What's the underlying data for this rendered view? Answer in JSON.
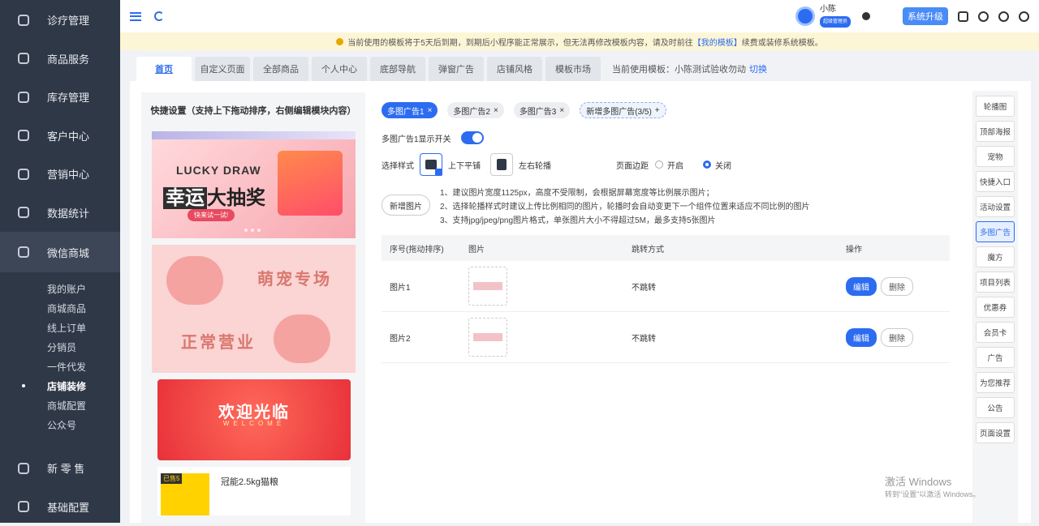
{
  "sidebar": {
    "nav": [
      {
        "label": "诊疗管理",
        "icon": "clinic-icon"
      },
      {
        "label": "商品服务",
        "icon": "goods-icon"
      },
      {
        "label": "库存管理",
        "icon": "inventory-icon"
      },
      {
        "label": "客户中心",
        "icon": "customer-icon"
      },
      {
        "label": "营销中心",
        "icon": "marketing-icon"
      },
      {
        "label": "数据统计",
        "icon": "stats-icon"
      },
      {
        "label": "微信商城",
        "icon": "wechat-mall-icon"
      }
    ],
    "sub": [
      "我的账户",
      "商城商品",
      "线上订单",
      "分销员",
      "一件代发",
      "店铺装修",
      "商城配置",
      "公众号"
    ],
    "bottom": [
      {
        "label": "新 零 售",
        "icon": "retail-icon"
      },
      {
        "label": "基础配置",
        "icon": "settings-icon"
      }
    ]
  },
  "topbar": {
    "user_name": "小陈",
    "user_role": "超级管理员",
    "upgrade_label": "系统升级"
  },
  "notice": {
    "text_before": "当前使用的模板将于5天后到期，到期后小程序能正常展示，但无法再修改模板内容，请及时前往",
    "link": "【我的模板】",
    "text_after": "续费或装修系统模板。"
  },
  "tabs": [
    "首页",
    "自定义页面",
    "全部商品",
    "个人中心",
    "底部导航",
    "弹窗广告",
    "店铺风格",
    "模板市场"
  ],
  "template_info": {
    "label": "当前使用模板：小陈测试验收勿动",
    "switch": "切换"
  },
  "preview": {
    "title": "快捷设置（支持上下拖动排序，右侧编辑模块内容）",
    "banner1": {
      "en": "LUCKY DRAW",
      "cn_a": "幸运",
      "cn_b": "大抽奖",
      "button": "快来试一试!"
    },
    "banner2": {
      "t1": "萌宠专场",
      "t2": "正常营业"
    },
    "banner3": {
      "cn": "欢迎光临",
      "en": "WELCOME"
    },
    "product": {
      "sold": "已售5",
      "name": "冠能2.5kg猫粮"
    }
  },
  "editor": {
    "chips": [
      "多图广告1",
      "多图广告2",
      "多图广告3"
    ],
    "chip_add": "新增多图广告(3/5)",
    "show_toggle_label": "多图广告1显示开关",
    "style_label": "选择样式",
    "style_options": [
      "上下平铺",
      "左右轮播"
    ],
    "margin_label": "页面边距",
    "margin_options": [
      "开启",
      "关闭"
    ],
    "add_image": "新增图片",
    "tips": [
      "1、建议图片宽度1125px，高度不受限制，会根据屏幕宽度等比例展示图片；",
      "2、选择轮播样式时建议上传比例相同的图片，轮播时会自动变更下一个组件位置来适应不同比例的图片",
      "3、支持jpg/jpeg/png图片格式，单张图片大小不得超过5M，最多支持5张图片"
    ],
    "table": {
      "headers": [
        "序号(拖动排序)",
        "图片",
        "跳转方式",
        "操作"
      ],
      "rows": [
        {
          "name": "图片1",
          "jump": "不跳转"
        },
        {
          "name": "图片2",
          "jump": "不跳转"
        }
      ],
      "edit": "编辑",
      "delete": "删除"
    }
  },
  "palette": [
    "轮播图",
    "顶部海报",
    "宠物",
    "快捷入口",
    "活动设置",
    "多图广告",
    "魔方",
    "项目列表",
    "优惠券",
    "会员卡",
    "广告",
    "为您推荐",
    "公告",
    "页面设置"
  ],
  "watermark": {
    "line1": "激活 Windows",
    "line2": "转到\"设置\"以激活 Windows。"
  },
  "colors": {
    "accent": "#2c6cf0",
    "sidebar_bg": "#2f3847",
    "notice_bg": "#fdf6d6"
  }
}
